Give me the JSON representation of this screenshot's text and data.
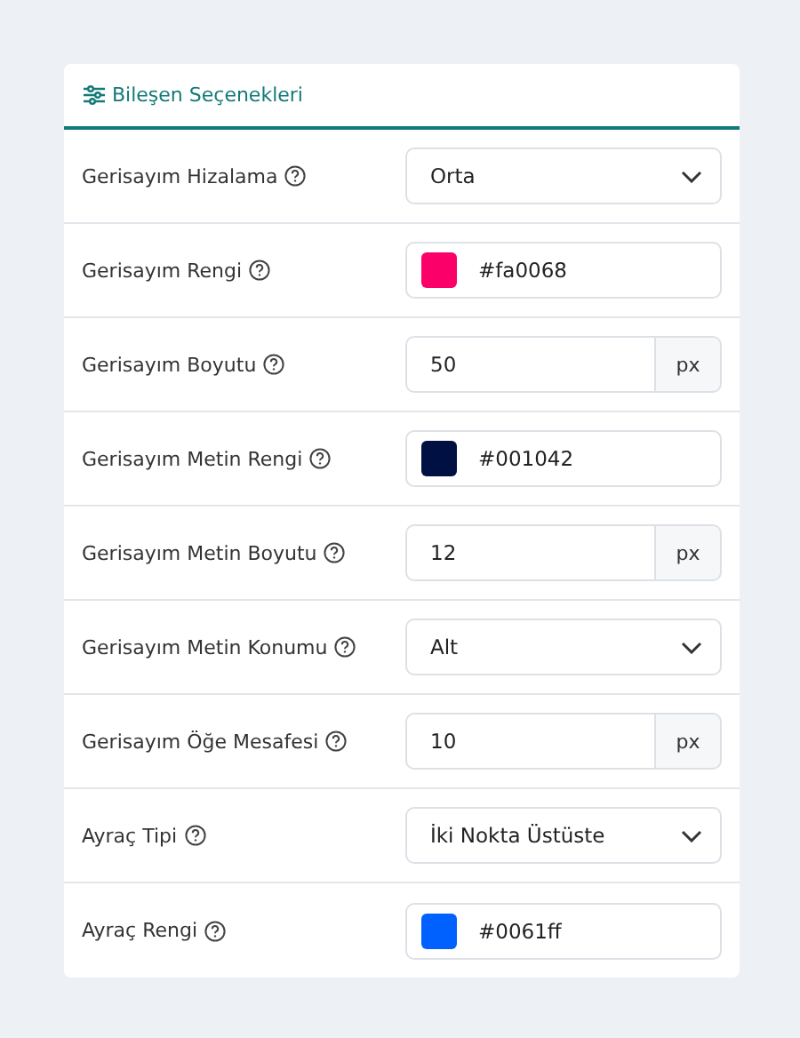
{
  "panel": {
    "title": "Bileşen Seçenekleri"
  },
  "options": [
    {
      "label": "Gerisayım Hizalama",
      "kind": "select",
      "value": "Orta"
    },
    {
      "label": "Gerisayım Rengi",
      "kind": "color",
      "value": "#fa0068",
      "color": "#fa0068"
    },
    {
      "label": "Gerisayım Boyutu",
      "kind": "number",
      "value": "50",
      "unit": "px"
    },
    {
      "label": "Gerisayım Metin Rengi",
      "kind": "color",
      "value": "#001042",
      "color": "#001042"
    },
    {
      "label": "Gerisayım Metin Boyutu",
      "kind": "number",
      "value": "12",
      "unit": "px"
    },
    {
      "label": "Gerisayım Metin Konumu",
      "kind": "select",
      "value": "Alt"
    },
    {
      "label": "Gerisayım Öğe Mesafesi",
      "kind": "number",
      "value": "10",
      "unit": "px"
    },
    {
      "label": "Ayraç Tipi",
      "kind": "select",
      "value": "İki Nokta Üstüste"
    },
    {
      "label": "Ayraç Rengi",
      "kind": "color",
      "value": "#0061ff",
      "color": "#0061ff"
    }
  ]
}
